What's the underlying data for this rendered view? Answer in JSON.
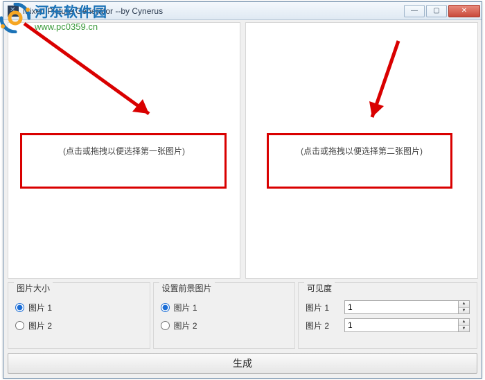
{
  "window": {
    "title": "Mixed Picture Generator     --by Cynerus"
  },
  "dropzones": {
    "left_hint": "(点击或拖拽以便选择第一张图片)",
    "right_hint": "(点击或拖拽以便选择第二张图片)"
  },
  "groups": {
    "size": {
      "title": "图片大小",
      "opt1": "图片 1",
      "opt2": "图片 2",
      "selected": "opt1"
    },
    "foreground": {
      "title": "设置前景图片",
      "opt1": "图片 1",
      "opt2": "图片 2",
      "selected": "opt1"
    },
    "visibility": {
      "title": "可见度",
      "row1_label": "图片 1",
      "row1_value": "1",
      "row2_label": "图片 2",
      "row2_value": "1"
    }
  },
  "generate_label": "生成",
  "watermark": {
    "site_name": "河东软件园",
    "site_url": "www.pc0359.cn"
  },
  "colors": {
    "highlight": "#d90000",
    "titlebar_grad_top": "#f4f8fc",
    "titlebar_grad_bot": "#dfe9f3",
    "close_red": "#c94a3b",
    "link_green": "#3a9a3a",
    "brand_blue": "#1c73b7"
  }
}
